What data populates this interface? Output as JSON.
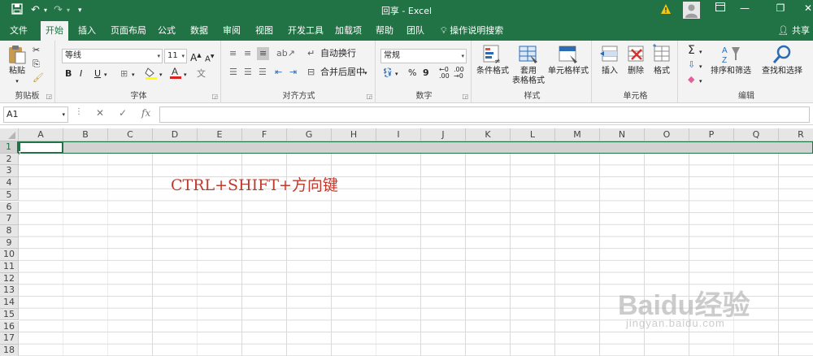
{
  "titlebar": {
    "title": "回享 - Excel",
    "bg": "#217346",
    "icons": [
      "save-icon",
      "undo-icon",
      "redo-icon",
      "customize-icon",
      "warning-icon",
      "account-icon",
      "ribbon-display-icon",
      "minimize-icon",
      "restore-icon",
      "close-icon"
    ]
  },
  "tabs": [
    "文件",
    "开始",
    "插入",
    "页面布局",
    "公式",
    "数据",
    "审阅",
    "视图",
    "开发工具",
    "加载项",
    "帮助",
    "团队"
  ],
  "tell_me": "操作说明搜索",
  "share": "共享",
  "ribbon": {
    "clipboard": {
      "label": "剪贴板",
      "paste": "粘贴"
    },
    "font": {
      "label": "字体",
      "name": "等线",
      "size": "11",
      "bold": "B",
      "italic": "I",
      "underline": "U",
      "grow": "A",
      "shrink": "A"
    },
    "alignment": {
      "label": "对齐方式",
      "wrap": "自动换行",
      "merge": "合并后居中"
    },
    "number": {
      "label": "数字",
      "format": "常规",
      "percent": "%",
      "comma": "9"
    },
    "styles": {
      "label": "样式",
      "conditional": "条件格式",
      "table_line1": "套用",
      "table_line2": "表格格式",
      "cell_styles": "单元格样式"
    },
    "cells": {
      "label": "单元格",
      "insert": "插入",
      "delete": "删除",
      "format": "格式"
    },
    "editing": {
      "label": "编辑",
      "sort": "排序和筛选",
      "find": "查找和选择"
    }
  },
  "formula_bar": {
    "name_box": "A1",
    "fx": "fx",
    "cancel": "✕",
    "enter": "✓",
    "value": ""
  },
  "columns": [
    "A",
    "B",
    "C",
    "D",
    "E",
    "F",
    "G",
    "H",
    "I",
    "J",
    "K",
    "L",
    "M",
    "N",
    "O",
    "P",
    "Q",
    "R"
  ],
  "rows": [
    "1",
    "2",
    "3",
    "4",
    "5",
    "6",
    "7",
    "8",
    "9",
    "10",
    "11",
    "12",
    "13",
    "14",
    "15",
    "16",
    "17",
    "18"
  ],
  "annotation": "CTRL+SHIFT+方向键",
  "watermark": {
    "text": "Baidu经验",
    "url": "jingyan.baidu.com"
  }
}
